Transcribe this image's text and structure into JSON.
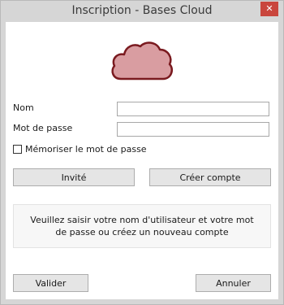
{
  "window": {
    "title": "Inscription - Bases Cloud",
    "close_glyph": "✕"
  },
  "logo": {
    "icon": "cloud-icon",
    "fill": "#d99da1",
    "stroke": "#7a1a1f"
  },
  "form": {
    "username_label": "Nom",
    "username_value": "",
    "password_label": "Mot de passe",
    "password_value": "",
    "remember_label": "Mémoriser le mot de passe",
    "remember_checked": false
  },
  "actions": {
    "guest_label": "Invité",
    "create_account_label": "Créer compte",
    "validate_label": "Valider",
    "cancel_label": "Annuler"
  },
  "message": "Veuillez saisir votre nom d'utilisateur et votre mot de passe ou créez un nouveau compte"
}
